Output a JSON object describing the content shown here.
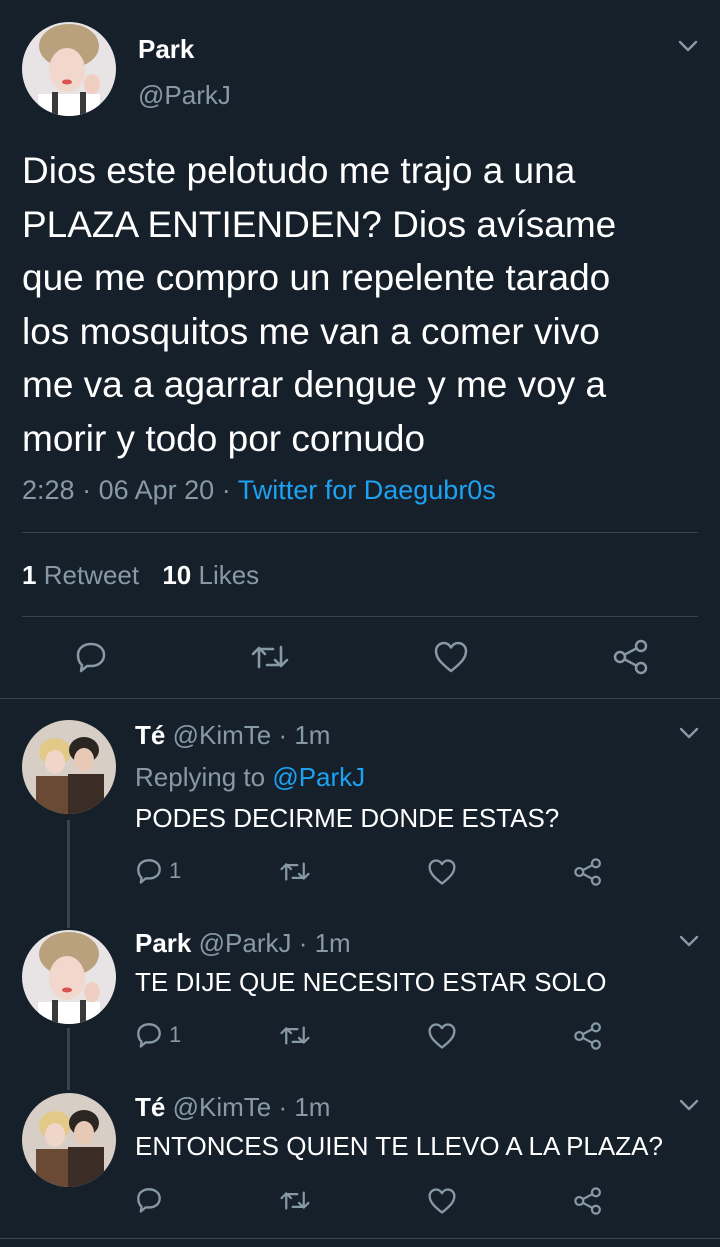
{
  "main_tweet": {
    "author_name": "Park",
    "handle": "@ParkJ",
    "text_lines": [
      "Dios este pelotudo me trajo a una",
      "PLAZA ENTIENDEN? Dios avísame",
      "que me compro un repelente tarado",
      "los mosquitos me van a comer vivo",
      "me va a agarrar dengue y me voy a",
      "morir y todo por cornudo"
    ],
    "time": "2:28",
    "date": "06 Apr 20",
    "sep": "·",
    "source": "Twitter for Daegubr0s",
    "retweet_count": "1",
    "retweet_label": "Retweet",
    "like_count": "10",
    "like_label": "Likes"
  },
  "replies": [
    {
      "author_name": "Té",
      "handle": "@KimTe",
      "meta": "· 1m",
      "replying_prefix": "Replying to",
      "replying_handle": "@ParkJ",
      "text": "PODES DECIRME DONDE ESTAS?",
      "reply_count": "1"
    },
    {
      "author_name": "Park",
      "handle": "@ParkJ",
      "meta": "· 1m",
      "text": "TE DIJE QUE NECESITO ESTAR SOLO",
      "reply_count": "1"
    },
    {
      "author_name": "Té",
      "handle": "@KimTe",
      "meta": "· 1m",
      "text": "ENTONCES QUIEN TE LLEVO A LA PLAZA?",
      "reply_count": ""
    }
  ],
  "colors": {
    "background": "#15202b",
    "muted": "#8899a6",
    "accent": "#1da1f2",
    "divider": "#38444d"
  }
}
